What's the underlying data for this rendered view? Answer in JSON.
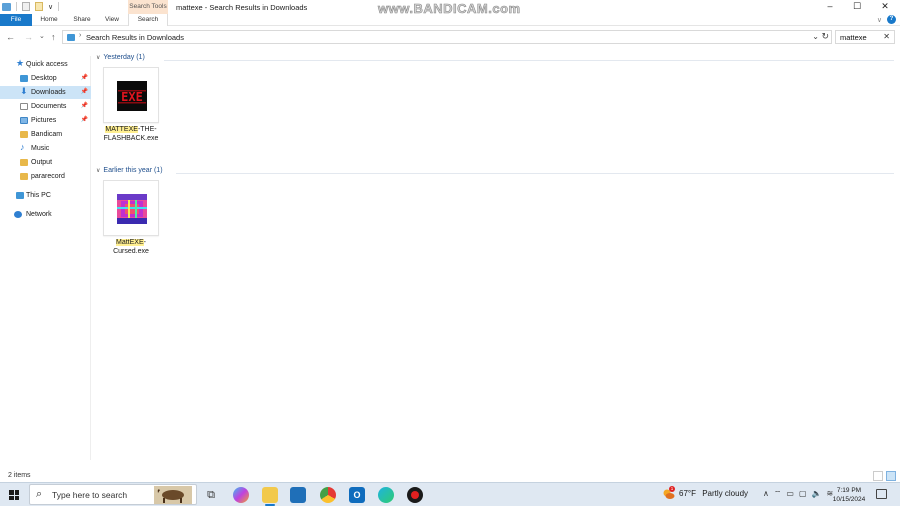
{
  "window": {
    "title": "mattexe - Search Results in Downloads",
    "context_tab": "Search Tools",
    "watermark": "www.BANDICAM.com",
    "controls": {
      "minimize": "–",
      "maximize": "☐",
      "close": "✕"
    }
  },
  "ribbon": {
    "tabs": [
      "File",
      "Home",
      "Share",
      "View",
      "Search"
    ],
    "help": "?"
  },
  "address": {
    "breadcrumb_sep": "›",
    "path": "Search Results in Downloads",
    "search_value": "mattexe",
    "nav": {
      "back": "←",
      "forward": "→",
      "recent": "⌄",
      "up": "↑"
    }
  },
  "sidebar": {
    "items": [
      {
        "label": "Quick access",
        "icon": "star-icon",
        "color": "#2f7fd1",
        "indent": 0,
        "pinned": false,
        "selected": false
      },
      {
        "label": "Desktop",
        "icon": "desktop-icon",
        "color": "#3f96d6",
        "indent": 1,
        "pinned": true,
        "selected": false
      },
      {
        "label": "Downloads",
        "icon": "download-icon",
        "color": "#2f7fd1",
        "indent": 1,
        "pinned": true,
        "selected": true
      },
      {
        "label": "Documents",
        "icon": "document-icon",
        "color": "#8a8a8a",
        "indent": 1,
        "pinned": true,
        "selected": false
      },
      {
        "label": "Pictures",
        "icon": "picture-icon",
        "color": "#3f96d6",
        "indent": 1,
        "pinned": true,
        "selected": false
      },
      {
        "label": "Bandicam",
        "icon": "folder-icon",
        "color": "#e8b84a",
        "indent": 1,
        "pinned": false,
        "selected": false
      },
      {
        "label": "Music",
        "icon": "music-icon",
        "color": "#2f7fd1",
        "indent": 1,
        "pinned": false,
        "selected": false
      },
      {
        "label": "Output",
        "icon": "folder-icon",
        "color": "#e8b84a",
        "indent": 1,
        "pinned": false,
        "selected": false
      },
      {
        "label": "pararecord",
        "icon": "folder-icon",
        "color": "#e8b84a",
        "indent": 1,
        "pinned": false,
        "selected": false
      },
      {
        "label": "This PC",
        "icon": "computer-icon",
        "color": "#3f96d6",
        "indent": 0,
        "pinned": false,
        "selected": false
      },
      {
        "label": "Network",
        "icon": "network-icon",
        "color": "#2f7fd1",
        "indent": 0,
        "pinned": false,
        "selected": false
      }
    ]
  },
  "groups": [
    {
      "header": "Yesterday (1)",
      "files": [
        {
          "highlight": "MATTEXE",
          "rest": "-THE-FLASHBACK.exe",
          "thumb": "exe-red-icon"
        }
      ]
    },
    {
      "header": "Earlier this year (1)",
      "files": [
        {
          "highlight": "MattEXE",
          "rest": "-Cursed.exe",
          "thumb": "exe-colorful-icon"
        }
      ]
    }
  ],
  "status": {
    "item_count": "2 items"
  },
  "taskbar": {
    "search_placeholder": "Type here to search",
    "weather_temp": "67°F",
    "weather_desc": "Partly cloudy",
    "time": "7:19 PM",
    "date": "10/15/2024",
    "weather_badge": "1",
    "apps": [
      "task-view-icon",
      "copilot-icon",
      "file-explorer-icon",
      "microsoft-store-icon",
      "chrome-icon",
      "outlook-icon",
      "edge-icon",
      "bandicam-icon"
    ]
  }
}
